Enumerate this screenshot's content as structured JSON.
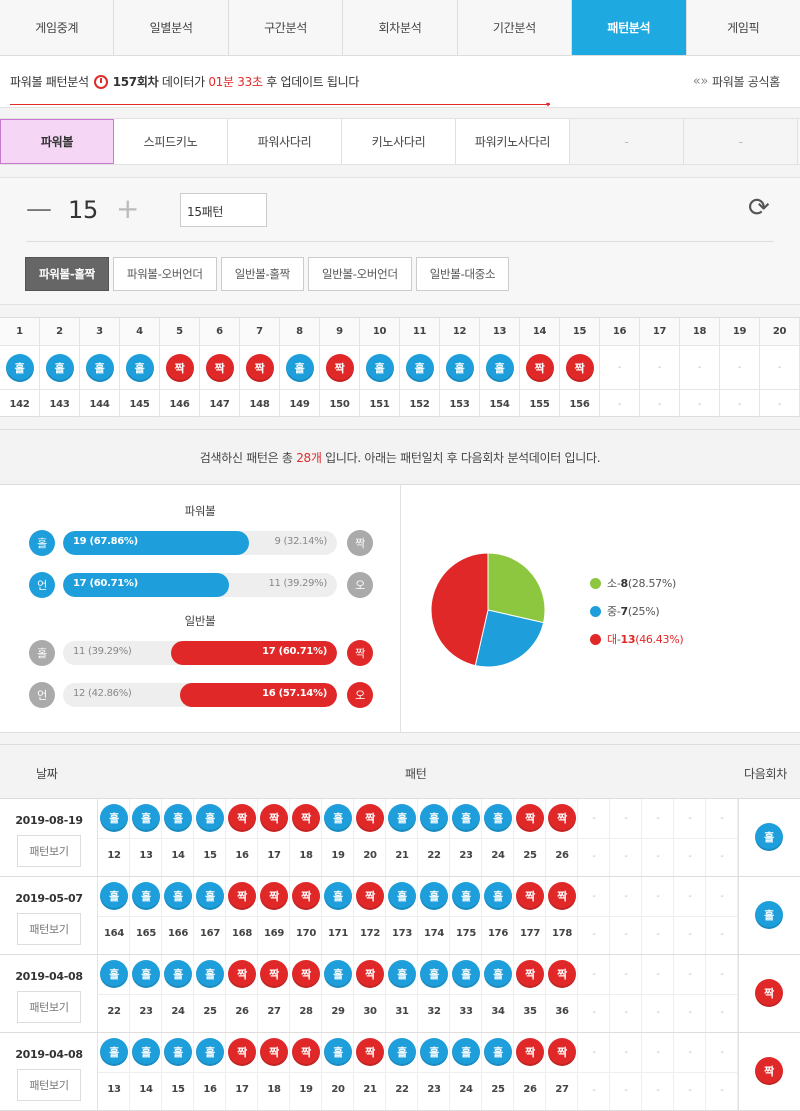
{
  "nav": {
    "tabs": [
      "게임중계",
      "일별분석",
      "구간분석",
      "회차분석",
      "기간분석",
      "패턴분석",
      "게임픽"
    ],
    "active": 5
  },
  "info": {
    "prefix": "파워볼 패턴분석",
    "round": "157회차",
    "mid": "데이터가",
    "time": "01분 33초",
    "suffix": "후 업데이트 됩니다",
    "official": "파워볼 공식홈"
  },
  "subtabs": {
    "items": [
      "파워볼",
      "스피드키노",
      "파워사다리",
      "키노사다리",
      "파워키노사다리",
      "-",
      "-"
    ],
    "active": 0
  },
  "control": {
    "count": "15",
    "pattern_value": "15패턴",
    "types": [
      "파워볼-홀짝",
      "파워볼-오버언더",
      "일반볼-홀짝",
      "일반볼-오버언더",
      "일반볼-대중소"
    ],
    "active_type": 0
  },
  "pattern": {
    "index": [
      "1",
      "2",
      "3",
      "4",
      "5",
      "6",
      "7",
      "8",
      "9",
      "10",
      "11",
      "12",
      "13",
      "14",
      "15",
      "16",
      "17",
      "18",
      "19",
      "20"
    ],
    "results": [
      "홀",
      "홀",
      "홀",
      "홀",
      "짝",
      "짝",
      "짝",
      "홀",
      "짝",
      "홀",
      "홀",
      "홀",
      "홀",
      "짝",
      "짝",
      "-",
      "-",
      "-",
      "-",
      "-"
    ],
    "rounds": [
      "142",
      "143",
      "144",
      "145",
      "146",
      "147",
      "148",
      "149",
      "150",
      "151",
      "152",
      "153",
      "154",
      "155",
      "156",
      "-",
      "-",
      "-",
      "-",
      "-"
    ]
  },
  "summary": {
    "pre": "검색하신 패턴은 총",
    "count": "28개",
    "post": "입니다. 아래는 패턴일치 후 다음회차 분석데이터 입니다."
  },
  "stats": {
    "powerball_title": "파워볼",
    "normal_title": "일반볼",
    "powerball": [
      {
        "left_ball": "홀",
        "left_text": "19 (67.86%)",
        "right_text": "9 (32.14%)",
        "right_ball": "짝",
        "left_pct": 67.86,
        "winner": "left",
        "color": "blue"
      },
      {
        "left_ball": "언",
        "left_text": "17 (60.71%)",
        "right_text": "11 (39.29%)",
        "right_ball": "오",
        "left_pct": 60.71,
        "winner": "left",
        "color": "blue"
      }
    ],
    "normal": [
      {
        "left_ball": "홀",
        "left_text": "11 (39.29%)",
        "right_text": "17 (60.71%)",
        "right_ball": "짝",
        "right_pct": 60.71,
        "winner": "right",
        "color": "red"
      },
      {
        "left_ball": "언",
        "left_text": "12 (42.86%)",
        "right_text": "16 (57.14%)",
        "right_ball": "오",
        "right_pct": 57.14,
        "winner": "right",
        "color": "red"
      }
    ]
  },
  "chart_data": {
    "type": "pie",
    "categories": [
      "소",
      "중",
      "대"
    ],
    "values": [
      8,
      7,
      13
    ],
    "percent_labels": [
      "(28.57%)",
      "(25%)",
      "(46.43%)"
    ],
    "colors": [
      "#8dc63f",
      "#1e9fdb",
      "#e02828"
    ]
  },
  "history": {
    "col_date": "날짜",
    "col_pattern": "패턴",
    "col_next": "다음회차",
    "view_label": "패턴보기",
    "rows": [
      {
        "date": "2019-08-19",
        "results": [
          "홀",
          "홀",
          "홀",
          "홀",
          "짝",
          "짝",
          "짝",
          "홀",
          "짝",
          "홀",
          "홀",
          "홀",
          "홀",
          "짝",
          "짝"
        ],
        "rounds": [
          "12",
          "13",
          "14",
          "15",
          "16",
          "17",
          "18",
          "19",
          "20",
          "21",
          "22",
          "23",
          "24",
          "25",
          "26"
        ],
        "next": "홀"
      },
      {
        "date": "2019-05-07",
        "results": [
          "홀",
          "홀",
          "홀",
          "홀",
          "짝",
          "짝",
          "짝",
          "홀",
          "짝",
          "홀",
          "홀",
          "홀",
          "홀",
          "짝",
          "짝"
        ],
        "rounds": [
          "164",
          "165",
          "166",
          "167",
          "168",
          "169",
          "170",
          "171",
          "172",
          "173",
          "174",
          "175",
          "176",
          "177",
          "178"
        ],
        "next": "홀"
      },
      {
        "date": "2019-04-08",
        "results": [
          "홀",
          "홀",
          "홀",
          "홀",
          "짝",
          "짝",
          "짝",
          "홀",
          "짝",
          "홀",
          "홀",
          "홀",
          "홀",
          "짝",
          "짝"
        ],
        "rounds": [
          "22",
          "23",
          "24",
          "25",
          "26",
          "27",
          "28",
          "29",
          "30",
          "31",
          "32",
          "33",
          "34",
          "35",
          "36"
        ],
        "next": "짝"
      },
      {
        "date": "2019-04-08",
        "results": [
          "홀",
          "홀",
          "홀",
          "홀",
          "짝",
          "짝",
          "짝",
          "홀",
          "짝",
          "홀",
          "홀",
          "홀",
          "홀",
          "짝",
          "짝"
        ],
        "rounds": [
          "13",
          "14",
          "15",
          "16",
          "17",
          "18",
          "19",
          "20",
          "21",
          "22",
          "23",
          "24",
          "25",
          "26",
          "27"
        ],
        "next": "짝"
      }
    ]
  }
}
